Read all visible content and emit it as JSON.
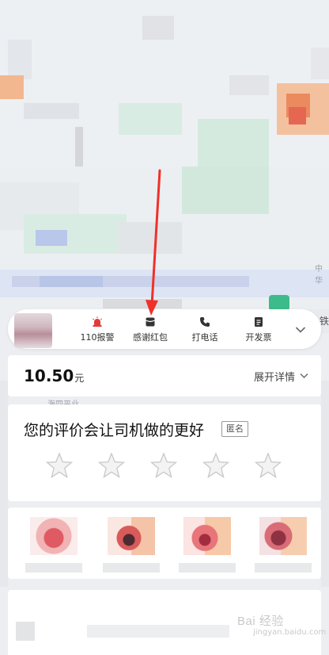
{
  "actions": [
    {
      "id": "alarm",
      "label": "110报警",
      "icon": "alarm-icon",
      "color": "#e23b3b"
    },
    {
      "id": "red-packet",
      "label": "感谢红包",
      "icon": "red-packet-icon",
      "color": "#333333"
    },
    {
      "id": "call",
      "label": "打电话",
      "icon": "phone-icon",
      "color": "#333333"
    },
    {
      "id": "invoice",
      "label": "开发票",
      "icon": "invoice-icon",
      "color": "#333333"
    }
  ],
  "fare": {
    "amount": "10.50",
    "unit": "元",
    "details_label": "展开详情"
  },
  "rating": {
    "title": "您的评价会让司机做的更好",
    "anonymous_label": "匿名",
    "stars_total": 5,
    "stars_selected": 0
  },
  "map_labels": {
    "road_label": "海四平业",
    "edge_label_1": "中华",
    "edge_label_2": "铁"
  },
  "watermark": {
    "text": "Bai 经验",
    "sub": "jingyan.baidu.com"
  },
  "colors": {
    "accent_red": "#e23b3b",
    "annotation_arrow": "#f0302a",
    "star_stroke": "#c8c8c8"
  }
}
